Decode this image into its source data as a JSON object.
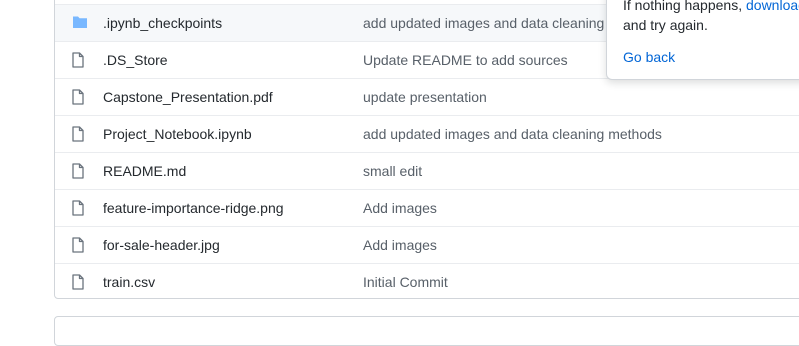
{
  "files": [
    {
      "name": ".ipynb_checkpoints",
      "type": "folder",
      "commit": "add updated images and data cleaning"
    },
    {
      "name": ".DS_Store",
      "type": "file",
      "commit": "Update README to add sources"
    },
    {
      "name": "Capstone_Presentation.pdf",
      "type": "file",
      "commit": "update presentation"
    },
    {
      "name": "Project_Notebook.ipynb",
      "type": "file",
      "commit": "add updated images and data cleaning methods"
    },
    {
      "name": "README.md",
      "type": "file",
      "commit": "small edit"
    },
    {
      "name": "feature-importance-ridge.png",
      "type": "file",
      "commit": "Add images"
    },
    {
      "name": "for-sale-header.jpg",
      "type": "file",
      "commit": "Add images"
    },
    {
      "name": "train.csv",
      "type": "file",
      "commit": "Initial Commit"
    }
  ],
  "popover": {
    "line1_prefix": "If nothing happens, ",
    "line1_link": "download",
    "line2": "and try again.",
    "go_back": "Go back"
  },
  "colors": {
    "folder_icon": "#79b8ff",
    "file_icon": "#6a737d",
    "link": "#0366d6"
  },
  "icons": {
    "folder": "folder-icon",
    "file": "file-icon"
  }
}
